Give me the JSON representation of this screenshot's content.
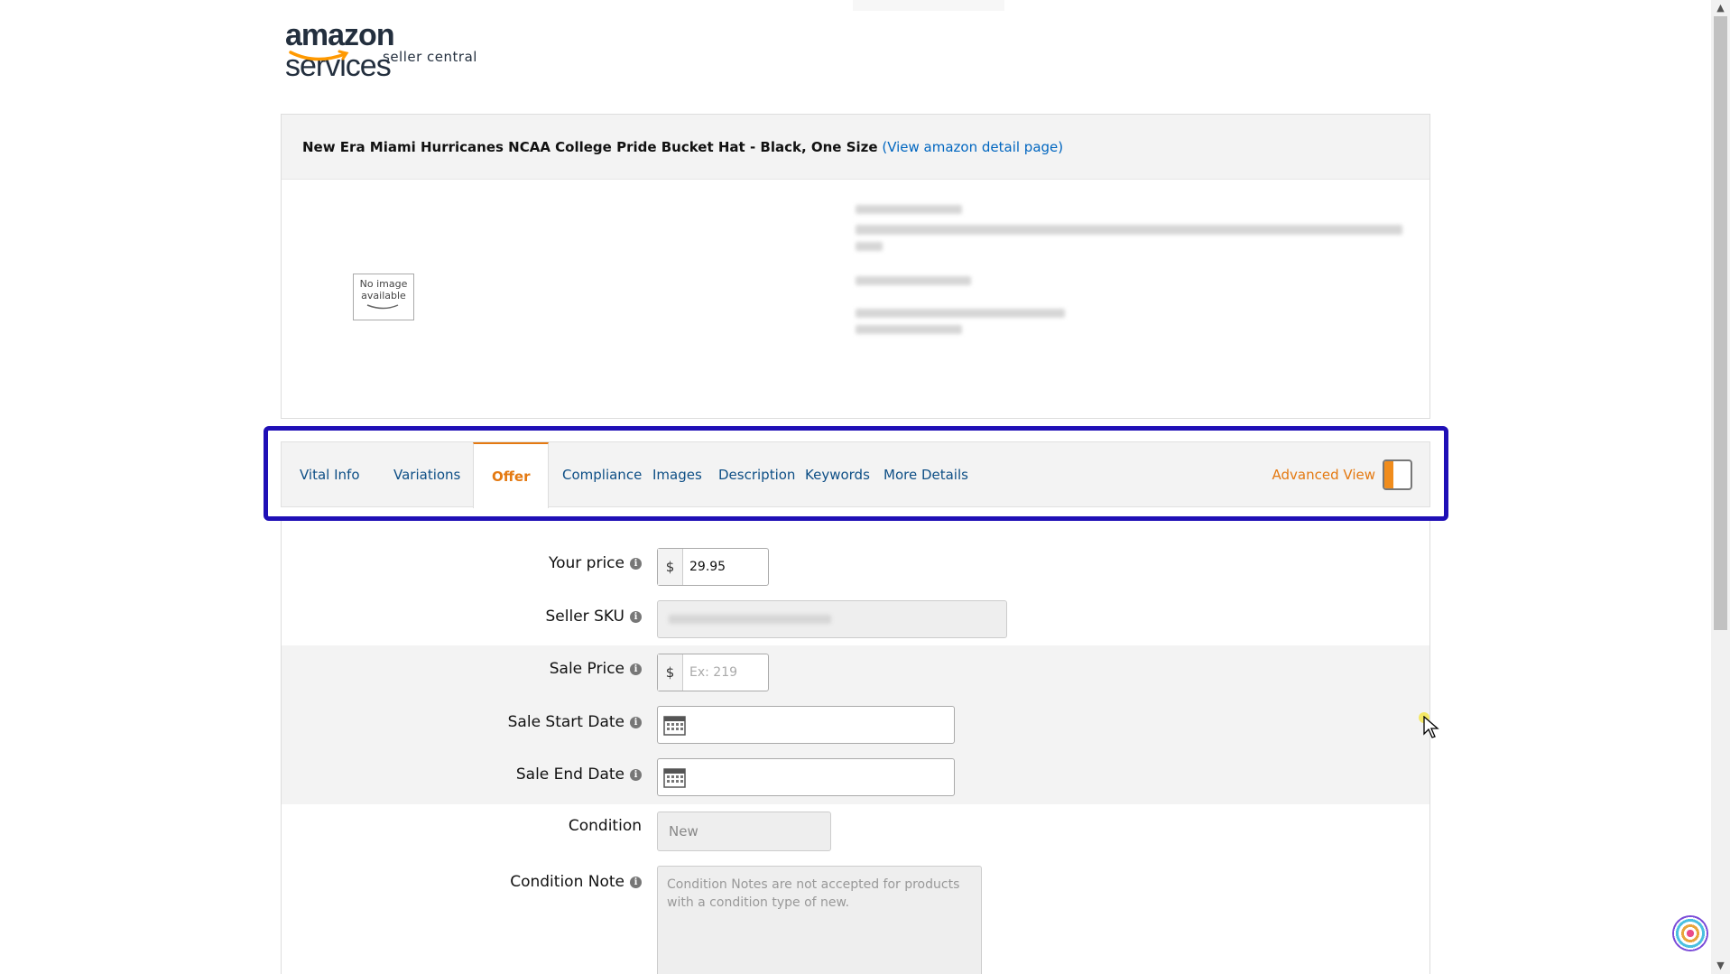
{
  "logo": {
    "brand": "amazon",
    "services": "services",
    "sub": "seller central"
  },
  "product": {
    "title": "New Era Miami Hurricanes NCAA College Pride Bucket Hat - Black, One Size",
    "detail_link": "(View amazon detail page)",
    "no_image_line1": "No image",
    "no_image_line2": "available"
  },
  "tabs": [
    {
      "label": "Vital Info"
    },
    {
      "label": "Variations"
    },
    {
      "label": "Offer"
    },
    {
      "label": "Compliance"
    },
    {
      "label": "Images"
    },
    {
      "label": "Description"
    },
    {
      "label": "Keywords"
    },
    {
      "label": "More Details"
    }
  ],
  "active_tab": "Offer",
  "advanced_view": {
    "label": "Advanced View"
  },
  "form": {
    "your_price": {
      "label": "Your price",
      "currency": "$",
      "value": "29.95"
    },
    "seller_sku": {
      "label": "Seller SKU"
    },
    "sale_price": {
      "label": "Sale Price",
      "currency": "$",
      "placeholder": "Ex: 219"
    },
    "sale_start": {
      "label": "Sale Start Date"
    },
    "sale_end": {
      "label": "Sale End Date"
    },
    "condition": {
      "label": "Condition",
      "value": "New"
    },
    "condition_note": {
      "label": "Condition Note",
      "placeholder": "Condition Notes are not accepted for products with a condition type of new."
    }
  },
  "colors": {
    "accent": "#e47911",
    "link": "#0066c0",
    "highlight": "#1f0fb6"
  }
}
